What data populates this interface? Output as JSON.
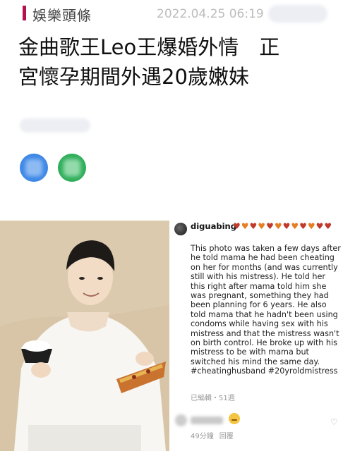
{
  "header": {
    "category": "娛樂頭條",
    "timestamp": "2022.04.25 06:19"
  },
  "headline": {
    "line1": "金曲歌王Leo王爆婚外情　正",
    "line2": "宮懷孕期間外遇20歲嫩妹"
  },
  "colors": {
    "accent": "#b3124e",
    "share_blue": "#3d87e6",
    "share_green": "#2fae5b"
  },
  "instagram_post": {
    "username": "diguabing",
    "hearts": [
      "♥",
      "♥",
      "♥",
      "♥",
      "♥",
      "♥",
      "♥",
      "♥",
      "♥",
      "♥",
      "♥",
      "♥"
    ],
    "caption": "This photo was taken a few days after he told mama he had been cheating on her for months (and was currently still with his mistress). He told her this right after mama told him she was pregnant, something they had been planning for 6 years. He also told mama that he hadn't been using condoms while having sex with his mistress and that the mistress wasn't on birth control. He broke up with his mistress to be with mama but switched his mind the same day. #cheatinghusband #20yroldmistress",
    "meta": "已編輯・51週",
    "comment": {
      "time": "49分鐘",
      "reply": "回覆"
    }
  }
}
